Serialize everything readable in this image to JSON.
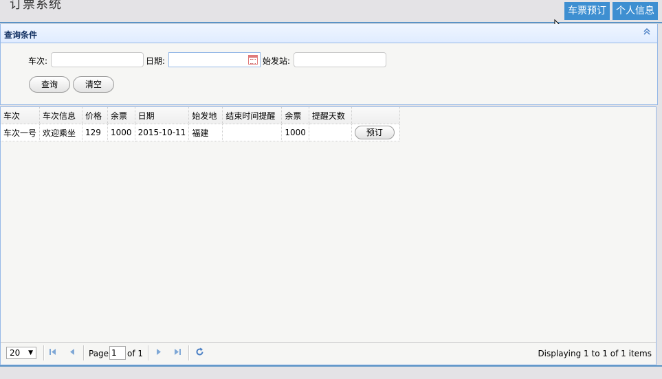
{
  "header": {
    "title": "订票系统",
    "btn_booking": "车票预订",
    "btn_profile": "个人信息"
  },
  "panel": {
    "title": "查询条件"
  },
  "filters": {
    "train_label": "车次:",
    "train_value": "",
    "date_label": "日期:",
    "date_value": "",
    "station_label": "始发站:",
    "station_value": "",
    "query_btn": "查询",
    "clear_btn": "清空"
  },
  "table": {
    "headers": [
      "车次",
      "车次信息",
      "价格",
      "余票",
      "日期",
      "始发地",
      "结束时间提醒",
      "余票",
      "提醒天数",
      ""
    ],
    "rows": [
      [
        "车次一号",
        "欢迎乘坐",
        "129",
        "1000",
        "2015-10-11",
        "福建",
        "",
        "1000",
        "",
        "预订"
      ]
    ]
  },
  "pager": {
    "page_size": "20",
    "page_label": "Page",
    "page_value": "1",
    "of_label": "of 1",
    "display": "Displaying 1 to 1 of 1 items"
  },
  "icons": {
    "collapse": "double-chevron-up-icon",
    "calendar": "calendar-icon",
    "first": "first-page-icon",
    "prev": "prev-page-icon",
    "next": "next-page-icon",
    "last": "last-page-icon",
    "refresh": "refresh-icon"
  },
  "colors": {
    "accent": "#3e8fd1",
    "border": "#95b8e7"
  }
}
